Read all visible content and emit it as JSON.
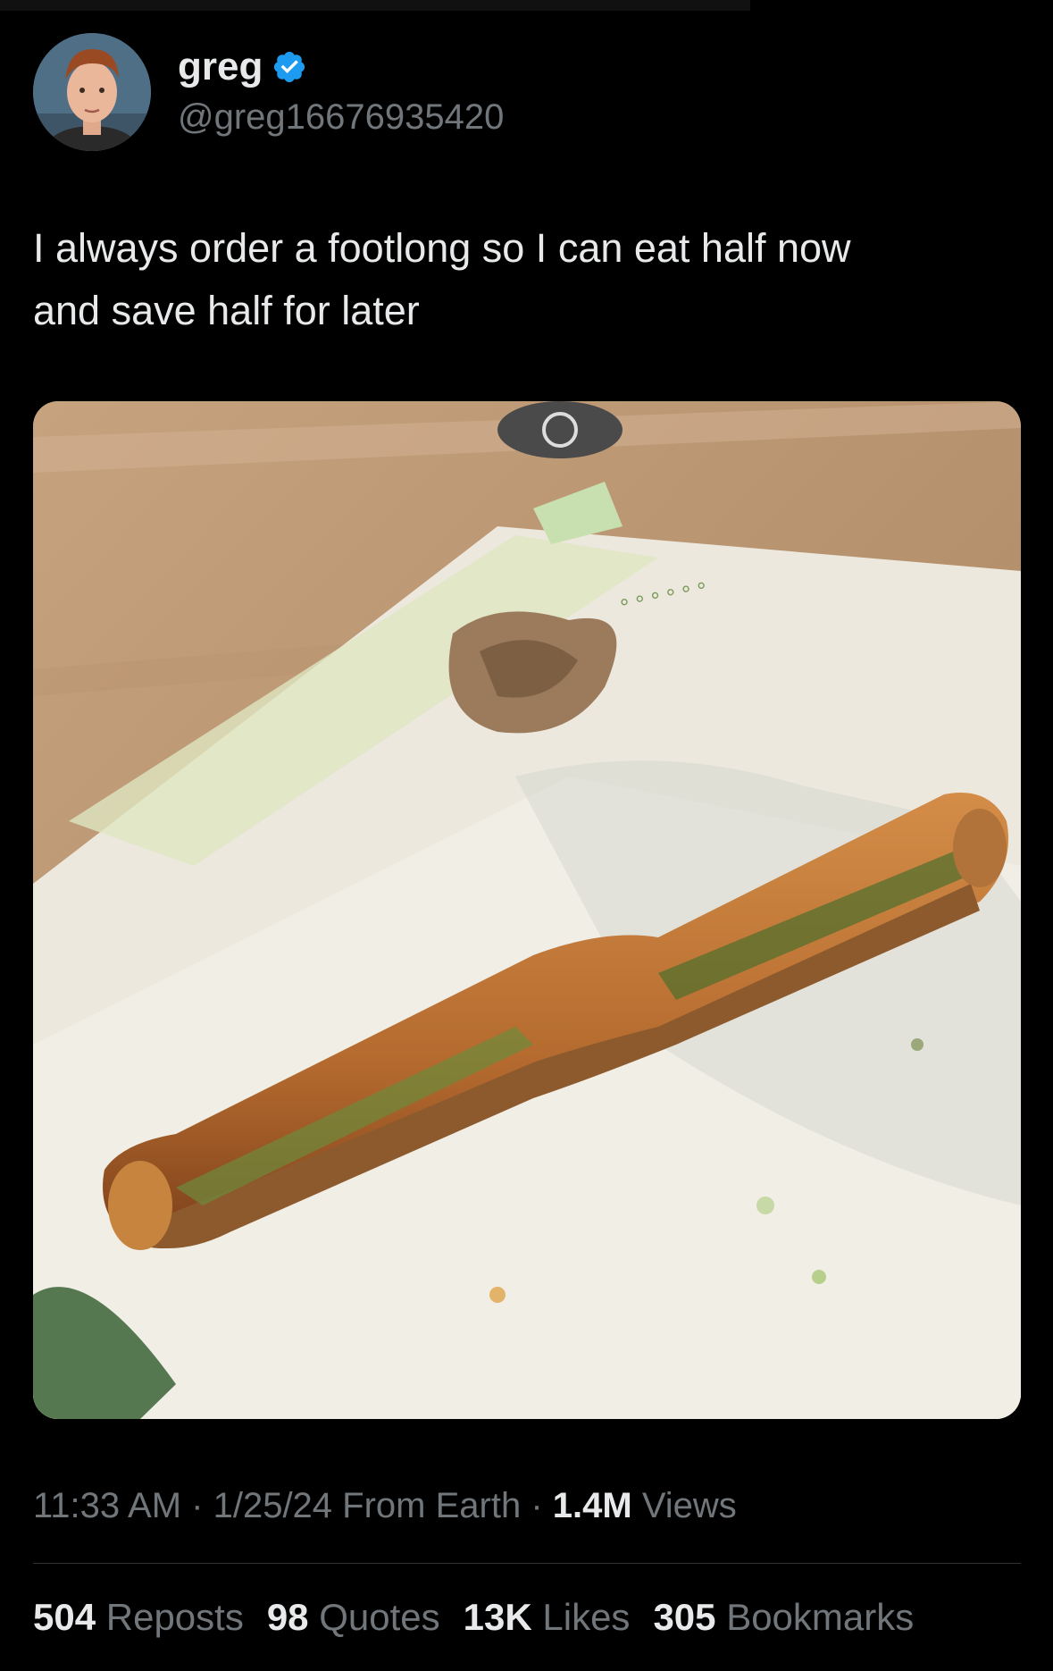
{
  "author": {
    "display_name": "greg",
    "handle": "@greg16676935420",
    "verified_icon": "verified-badge-icon",
    "avatar_alt": "avatar"
  },
  "tweet": {
    "text": "I always order a footlong so I can eat half now\nand save half for later"
  },
  "meta": {
    "time": "11:33 AM",
    "sep1": " · ",
    "date": "1/25/24",
    "source": " From Earth",
    "sep2": " · ",
    "views_count": "1.4M",
    "views_label": " Views"
  },
  "stats": [
    {
      "count": "504",
      "label": "Reposts"
    },
    {
      "count": "98",
      "label": "Quotes"
    },
    {
      "count": "13K",
      "label": "Likes"
    },
    {
      "count": "305",
      "label": "Bookmarks"
    }
  ],
  "colors": {
    "background": "#000000",
    "text": "#e7e9ea",
    "muted": "#71767b",
    "verified": "#1d9bf0",
    "divider": "#2f3336"
  }
}
